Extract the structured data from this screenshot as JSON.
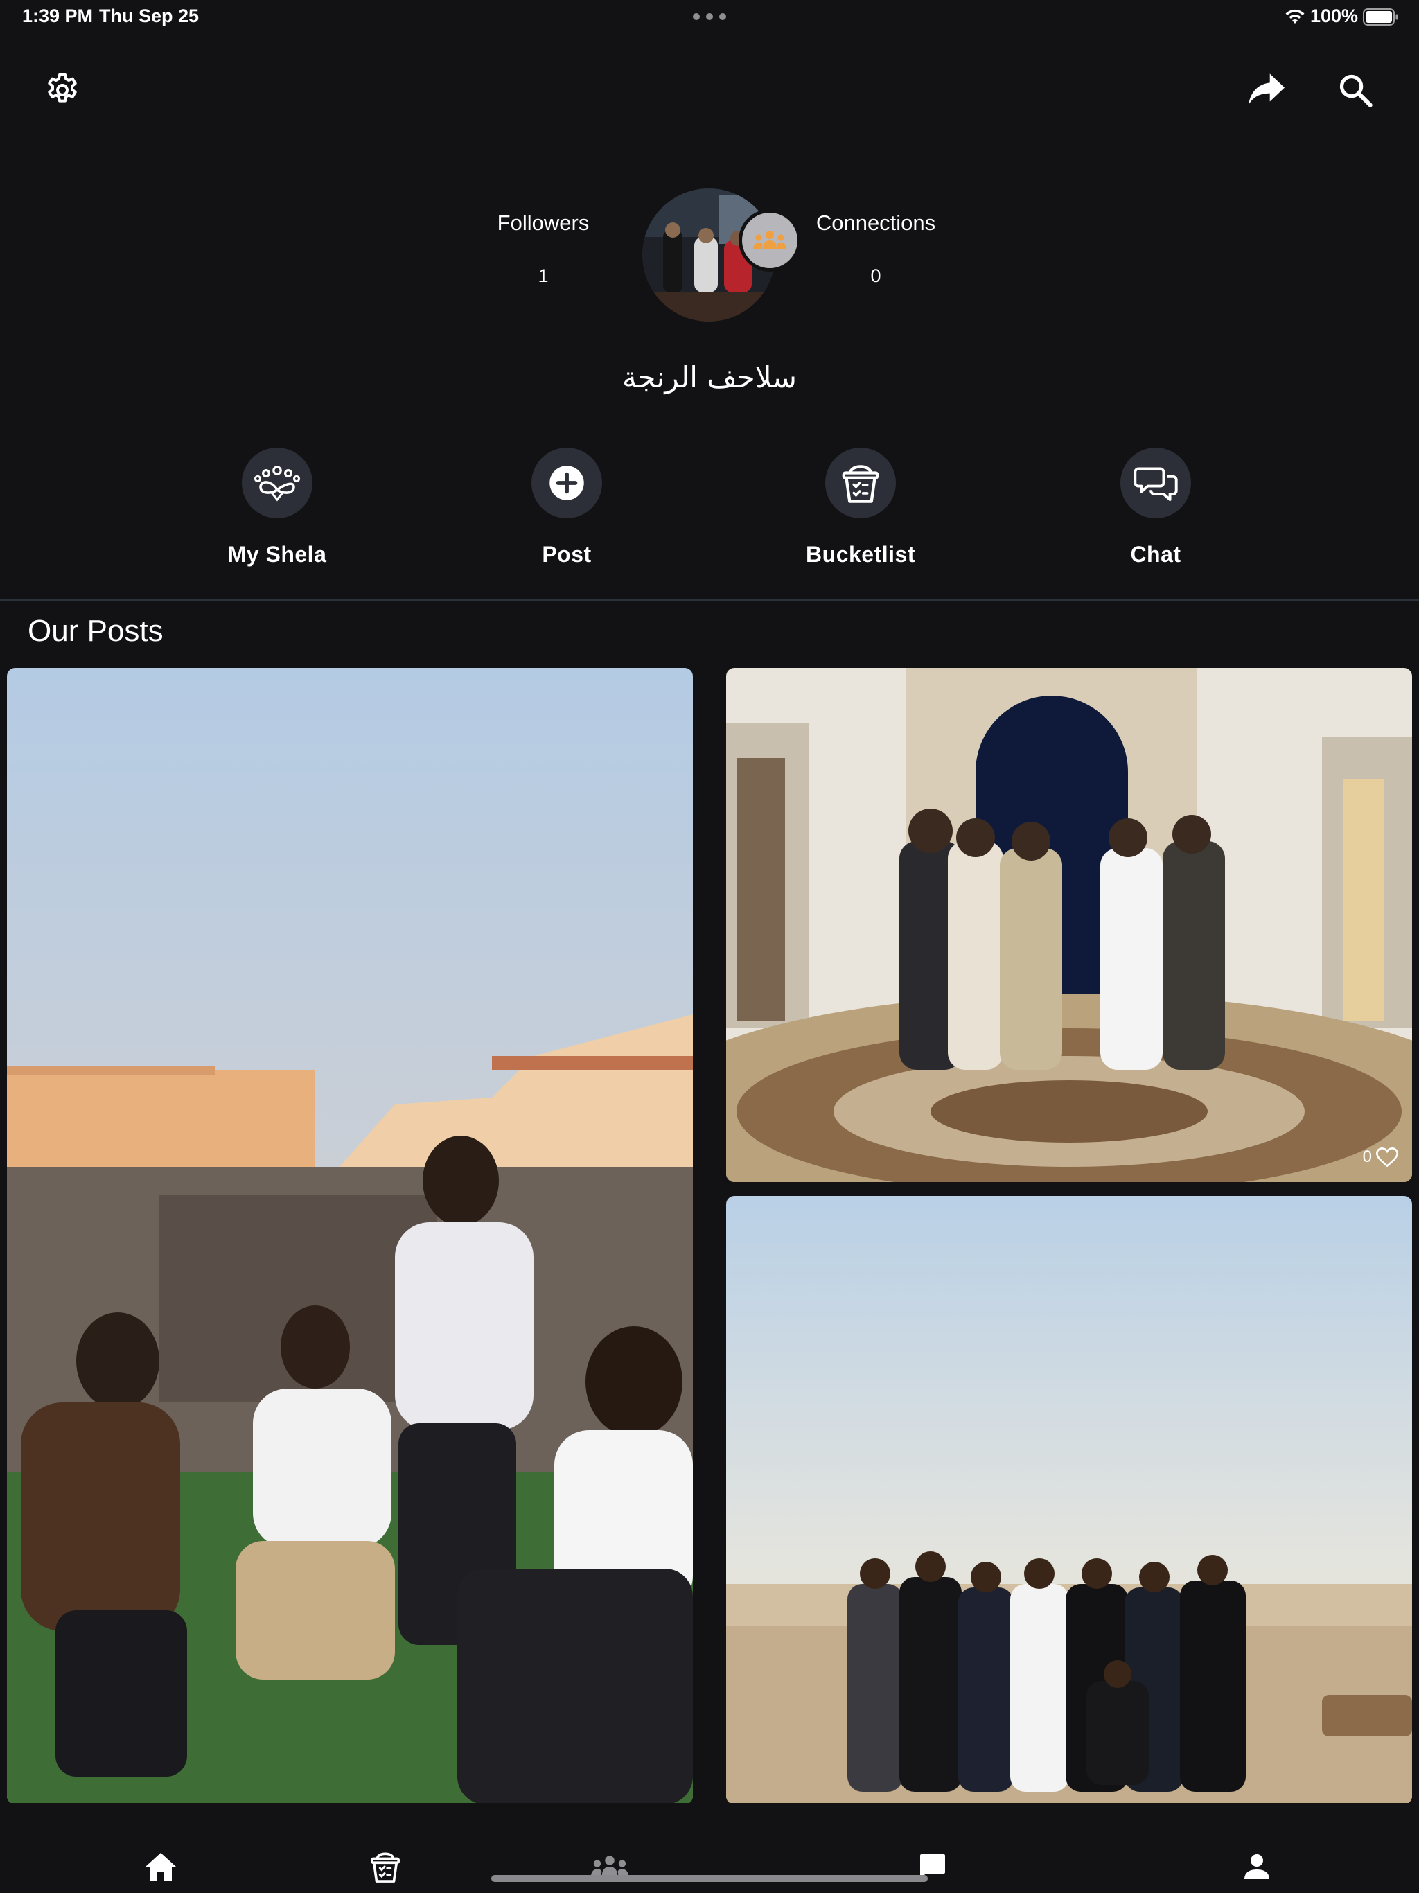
{
  "status_bar": {
    "time": "1:39 PM",
    "date": "Thu Sep 25",
    "battery": "100%"
  },
  "top_bar": {
    "settings_icon": "gear-icon",
    "share_icon": "share-arrow-icon",
    "search_icon": "search-icon"
  },
  "profile": {
    "followers_label": "Followers",
    "followers_count": "1",
    "connections_label": "Connections",
    "connections_count": "0",
    "group_name": "سلاحف الرنجة"
  },
  "actions": [
    {
      "label": "My Shela",
      "icon": "people-infinity-icon"
    },
    {
      "label": "Post",
      "icon": "plus-circle-icon"
    },
    {
      "label": "Bucketlist",
      "icon": "bucket-icon"
    },
    {
      "label": "Chat",
      "icon": "chat-bubbles-icon"
    }
  ],
  "posts_section": {
    "title": "Our Posts",
    "posts": [
      {
        "likes": ""
      },
      {
        "likes": "0"
      },
      {
        "likes": ""
      }
    ]
  },
  "bottom_nav": {
    "items": [
      {
        "icon": "home-icon",
        "active": true
      },
      {
        "icon": "bucket-icon",
        "active": false
      },
      {
        "icon": "group-icon",
        "active": false
      },
      {
        "icon": "chat-icon",
        "active": false
      },
      {
        "icon": "person-icon",
        "active": false
      }
    ]
  },
  "colors": {
    "background": "#121214",
    "action_circle": "#2c2f37",
    "divider": "#2b323d",
    "inactive_icon": "#8e8e93",
    "badge": "#b7b7bb",
    "badge_icon": "#f0a040"
  }
}
